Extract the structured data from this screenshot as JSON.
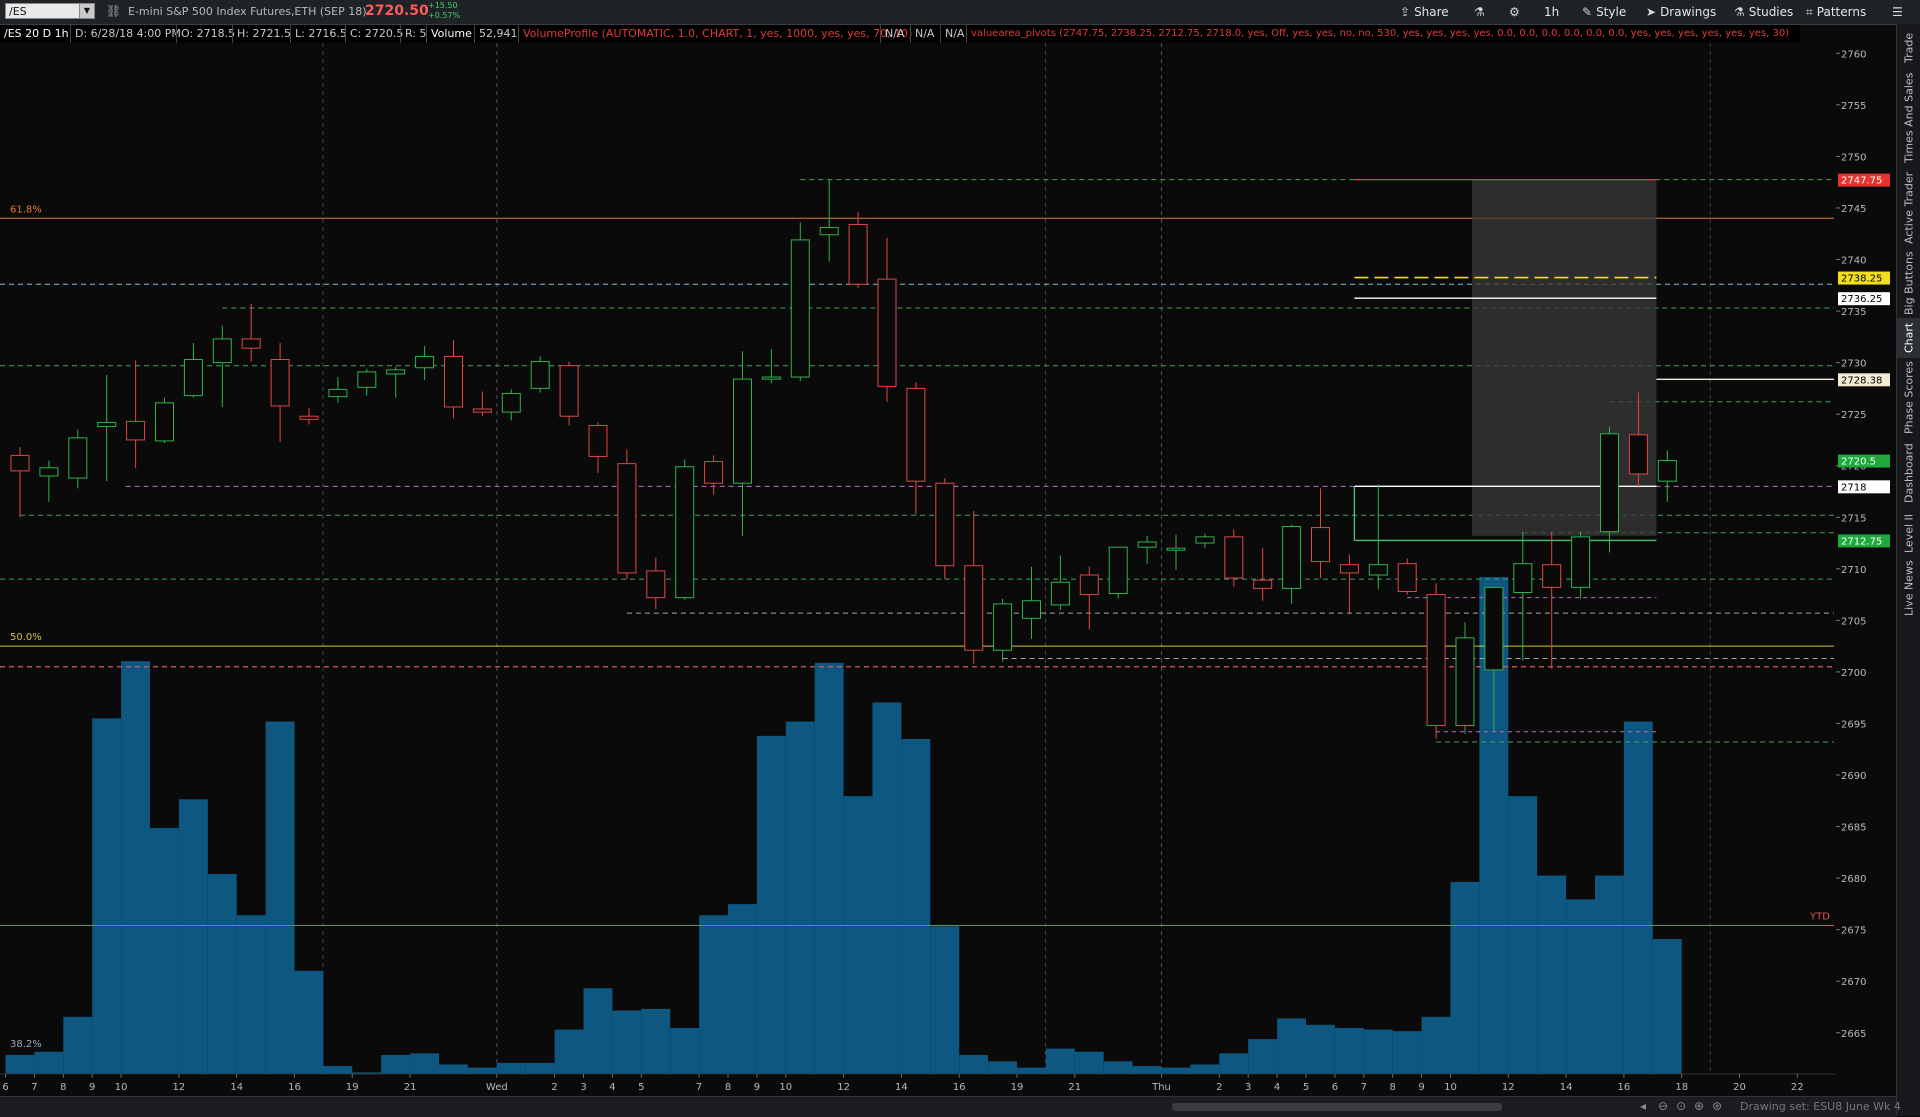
{
  "toolbar": {
    "symbol": "/ES",
    "instrument": "E-mini S&P 500 Index Futures,ETH (SEP 18)",
    "last": "2720.50",
    "change": "+15.50",
    "change_pct": "+0.57%",
    "buttons": {
      "share": "Share",
      "timeframe": "1h",
      "style": "Style",
      "drawings": "Drawings",
      "studies": "Studies",
      "patterns": "Patterns"
    }
  },
  "status": {
    "title": "/ES 20 D 1h",
    "date": "D: 6/28/18 4:00 PM",
    "open": "O: 2718.5",
    "high": "H: 2721.5",
    "low": "L: 2716.5",
    "close": "C: 2720.5",
    "range": "R: 5",
    "volume_label": "Volume",
    "volume_value": "52,941",
    "volume_profile": "VolumeProfile (AUTOMATIC, 1.0, CHART, 1, yes, 1000, yes, yes, 70, 10)",
    "na1": "N/A",
    "na2": "N/A",
    "na3": "N/A",
    "pivots": "valuearea_pivots (2747.75, 2738.25, 2712.75, 2718.0, yes, Off, yes, yes, no, no, 530, yes, yes, yes, yes, 0.0, 0.0, 0.0, 0.0, 0.0, 0.0, yes, yes, yes, yes, yes, yes, 30)"
  },
  "right_tabs": [
    "Trade",
    "Times And Sales",
    "Active Trader",
    "Big Buttons",
    "Chart",
    "Phase Scores",
    "Dashboard",
    "Level II",
    "Live News"
  ],
  "active_tab": "Chart",
  "footer": {
    "drawing_set": "Drawing set: ESU8 June Wk 4"
  },
  "chart_data": {
    "type": "candlestick",
    "ylim": [
      2661,
      2761
    ],
    "y_ticks": [
      "2760",
      "2755",
      "2750",
      "2745",
      "2740",
      "2735",
      "2730",
      "2725",
      "2720",
      "2715",
      "2710",
      "2705",
      "2700",
      "2695",
      "2690",
      "2685",
      "2680",
      "2675",
      "2670",
      "2665"
    ],
    "x_ticks": [
      {
        "label": "6",
        "i": 0
      },
      {
        "label": "7",
        "i": 1
      },
      {
        "label": "8",
        "i": 2
      },
      {
        "label": "9",
        "i": 3
      },
      {
        "label": "10",
        "i": 4
      },
      {
        "label": "12",
        "i": 6
      },
      {
        "label": "14",
        "i": 8
      },
      {
        "label": "16",
        "i": 10
      },
      {
        "label": "19",
        "i": 12
      },
      {
        "label": "21",
        "i": 14
      },
      {
        "label": "Wed",
        "i": 17
      },
      {
        "label": "2",
        "i": 19
      },
      {
        "label": "3",
        "i": 20
      },
      {
        "label": "4",
        "i": 21
      },
      {
        "label": "5",
        "i": 22
      },
      {
        "label": "7",
        "i": 24
      },
      {
        "label": "8",
        "i": 25
      },
      {
        "label": "9",
        "i": 26
      },
      {
        "label": "10",
        "i": 27
      },
      {
        "label": "12",
        "i": 29
      },
      {
        "label": "14",
        "i": 31
      },
      {
        "label": "16",
        "i": 33
      },
      {
        "label": "19",
        "i": 35
      },
      {
        "label": "21",
        "i": 37
      },
      {
        "label": "Thu",
        "i": 40
      },
      {
        "label": "2",
        "i": 42
      },
      {
        "label": "3",
        "i": 43
      },
      {
        "label": "4",
        "i": 44
      },
      {
        "label": "5",
        "i": 45
      },
      {
        "label": "6",
        "i": 46
      },
      {
        "label": "7",
        "i": 47
      },
      {
        "label": "8",
        "i": 48
      },
      {
        "label": "9",
        "i": 49
      },
      {
        "label": "10",
        "i": 50
      },
      {
        "label": "12",
        "i": 52
      },
      {
        "label": "14",
        "i": 54
      },
      {
        "label": "16",
        "i": 56
      },
      {
        "label": "18",
        "i": 58
      },
      {
        "label": "20",
        "i": 60
      },
      {
        "label": "22",
        "i": 62
      }
    ],
    "candles": [
      {
        "o": 2721.0,
        "h": 2721.8,
        "l": 2715.0,
        "c": 2719.5
      },
      {
        "o": 2719.0,
        "h": 2720.5,
        "l": 2716.5,
        "c": 2719.8
      },
      {
        "o": 2718.8,
        "h": 2723.5,
        "l": 2717.8,
        "c": 2722.7
      },
      {
        "o": 2723.8,
        "h": 2728.8,
        "l": 2718.5,
        "c": 2724.2
      },
      {
        "o": 2724.3,
        "h": 2730.2,
        "l": 2719.8,
        "c": 2722.5
      },
      {
        "o": 2722.4,
        "h": 2726.6,
        "l": 2722.2,
        "c": 2726.1
      },
      {
        "o": 2726.8,
        "h": 2731.9,
        "l": 2726.6,
        "c": 2730.3
      },
      {
        "o": 2730.0,
        "h": 2733.6,
        "l": 2725.7,
        "c": 2732.3
      },
      {
        "o": 2732.3,
        "h": 2735.7,
        "l": 2730.1,
        "c": 2731.4
      },
      {
        "o": 2730.3,
        "h": 2731.9,
        "l": 2722.3,
        "c": 2725.8
      },
      {
        "o": 2724.8,
        "h": 2725.6,
        "l": 2724.0,
        "c": 2724.5
      },
      {
        "o": 2726.7,
        "h": 2728.6,
        "l": 2726.1,
        "c": 2727.4
      },
      {
        "o": 2727.6,
        "h": 2729.4,
        "l": 2726.8,
        "c": 2729.1
      },
      {
        "o": 2728.9,
        "h": 2729.6,
        "l": 2726.6,
        "c": 2729.3
      },
      {
        "o": 2729.5,
        "h": 2731.6,
        "l": 2728.3,
        "c": 2730.6
      },
      {
        "o": 2730.6,
        "h": 2732.2,
        "l": 2724.6,
        "c": 2725.7
      },
      {
        "o": 2725.5,
        "h": 2727.2,
        "l": 2724.8,
        "c": 2725.2
      },
      {
        "o": 2725.2,
        "h": 2727.4,
        "l": 2724.4,
        "c": 2727.0
      },
      {
        "o": 2727.5,
        "h": 2730.6,
        "l": 2727.1,
        "c": 2730.1
      },
      {
        "o": 2729.7,
        "h": 2730.1,
        "l": 2723.9,
        "c": 2724.8
      },
      {
        "o": 2723.9,
        "h": 2724.2,
        "l": 2719.3,
        "c": 2720.9
      },
      {
        "o": 2720.2,
        "h": 2721.6,
        "l": 2709.0,
        "c": 2709.6
      },
      {
        "o": 2709.8,
        "h": 2711.1,
        "l": 2706.1,
        "c": 2707.2
      },
      {
        "o": 2707.2,
        "h": 2720.6,
        "l": 2707.0,
        "c": 2719.9
      },
      {
        "o": 2720.4,
        "h": 2721.0,
        "l": 2717.2,
        "c": 2718.3
      },
      {
        "o": 2718.3,
        "h": 2731.1,
        "l": 2713.2,
        "c": 2728.4
      },
      {
        "o": 2728.4,
        "h": 2731.3,
        "l": 2728.0,
        "c": 2728.6
      },
      {
        "o": 2728.6,
        "h": 2743.6,
        "l": 2728.2,
        "c": 2741.9
      },
      {
        "o": 2742.4,
        "h": 2747.8,
        "l": 2739.8,
        "c": 2743.1
      },
      {
        "o": 2743.4,
        "h": 2744.6,
        "l": 2737.2,
        "c": 2737.6
      },
      {
        "o": 2738.1,
        "h": 2742.1,
        "l": 2726.2,
        "c": 2727.7
      },
      {
        "o": 2727.5,
        "h": 2728.1,
        "l": 2715.3,
        "c": 2718.5
      },
      {
        "o": 2718.3,
        "h": 2718.8,
        "l": 2709.0,
        "c": 2710.3
      },
      {
        "o": 2710.3,
        "h": 2715.6,
        "l": 2700.8,
        "c": 2702.1
      },
      {
        "o": 2702.1,
        "h": 2707.1,
        "l": 2701.0,
        "c": 2706.6
      },
      {
        "o": 2705.2,
        "h": 2710.2,
        "l": 2703.2,
        "c": 2706.9
      },
      {
        "o": 2706.5,
        "h": 2711.3,
        "l": 2706.0,
        "c": 2708.7
      },
      {
        "o": 2709.4,
        "h": 2710.2,
        "l": 2704.1,
        "c": 2707.5
      },
      {
        "o": 2707.6,
        "h": 2712.0,
        "l": 2707.1,
        "c": 2712.1
      },
      {
        "o": 2712.1,
        "h": 2713.2,
        "l": 2710.5,
        "c": 2712.6
      },
      {
        "o": 2711.8,
        "h": 2713.3,
        "l": 2709.9,
        "c": 2712.0
      },
      {
        "o": 2712.5,
        "h": 2713.4,
        "l": 2712.0,
        "c": 2713.1
      },
      {
        "o": 2713.1,
        "h": 2713.8,
        "l": 2708.3,
        "c": 2709.1
      },
      {
        "o": 2708.9,
        "h": 2712.0,
        "l": 2706.9,
        "c": 2708.1
      },
      {
        "o": 2708.1,
        "h": 2714.3,
        "l": 2706.6,
        "c": 2714.1
      },
      {
        "o": 2714.0,
        "h": 2717.8,
        "l": 2709.1,
        "c": 2710.7
      },
      {
        "o": 2710.4,
        "h": 2711.4,
        "l": 2705.6,
        "c": 2709.6
      },
      {
        "o": 2709.4,
        "h": 2718.2,
        "l": 2708.0,
        "c": 2710.4
      },
      {
        "o": 2710.5,
        "h": 2711.0,
        "l": 2707.5,
        "c": 2707.8
      },
      {
        "o": 2707.5,
        "h": 2708.6,
        "l": 2693.5,
        "c": 2694.8
      },
      {
        "o": 2694.8,
        "h": 2704.8,
        "l": 2694.0,
        "c": 2703.3
      },
      {
        "o": 2700.2,
        "h": 2708.3,
        "l": 2694.3,
        "c": 2708.2
      },
      {
        "o": 2707.7,
        "h": 2713.6,
        "l": 2701.1,
        "c": 2710.5
      },
      {
        "o": 2710.4,
        "h": 2713.6,
        "l": 2700.3,
        "c": 2708.2
      },
      {
        "o": 2708.2,
        "h": 2713.6,
        "l": 2707.1,
        "c": 2713.1
      },
      {
        "o": 2713.6,
        "h": 2723.8,
        "l": 2711.6,
        "c": 2723.1
      },
      {
        "o": 2723.0,
        "h": 2727.1,
        "l": 2717.8,
        "c": 2719.2
      },
      {
        "o": 2718.5,
        "h": 2721.5,
        "l": 2716.5,
        "c": 2720.5
      }
    ],
    "volume_profile": {
      "price_max": 2709.2,
      "bars": [
        1.2,
        1.4,
        3.6,
        22.4,
        26.0,
        15.5,
        17.3,
        12.6,
        10.0,
        22.2,
        6.5,
        0.5,
        0.1,
        1.2,
        1.3,
        0.6,
        0.4,
        0.7,
        0.7,
        2.8,
        5.4,
        4.0,
        4.1,
        2.9,
        10.0,
        10.7,
        21.3,
        22.2,
        25.9,
        17.5,
        23.4,
        21.1,
        9.3,
        1.2,
        0.8,
        0.4,
        1.6,
        1.4,
        0.8,
        0.5,
        0.4,
        0.6,
        1.3,
        2.2,
        3.5,
        3.1,
        2.9,
        2.8,
        2.7,
        3.6,
        12.1,
        31.3,
        17.5,
        12.5,
        11.0,
        12.5,
        22.2,
        8.5,
        0,
        0,
        0,
        0,
        0,
        0
      ]
    },
    "levels": [
      {
        "price": 2747.75,
        "color": "#4ac26b",
        "dash": true,
        "label": "2747.75",
        "label_bg": "#e3342f",
        "label_fg": "#ffffff"
      },
      {
        "price": 2738.25,
        "color": "#f2d63a",
        "dash": true,
        "label": "2738.25",
        "label_bg": "#f2e01f",
        "label_fg": "#000000"
      },
      {
        "price": 2736.25,
        "color": "#ffffff",
        "dash": false,
        "label": "2736.25",
        "label_bg": "#ffffff",
        "label_fg": "#000000"
      },
      {
        "price": 2728.38,
        "color": "#f5e9c6",
        "dash": false,
        "label": "2728.38",
        "label_bg": "#f3ecd2",
        "label_fg": "#000000"
      },
      {
        "price": 2720.5,
        "color": "#4ac26b",
        "dash": false,
        "label": "2720.5",
        "label_bg": "#1fa83b",
        "label_fg": "#ffffff"
      },
      {
        "price": 2718.0,
        "color": "#ffffff",
        "dash": false,
        "label": "2718",
        "label_bg": "#ffffff",
        "label_fg": "#000000"
      },
      {
        "price": 2712.75,
        "color": "#4ac26b",
        "dash": false,
        "label": "2712.75",
        "label_bg": "#1fa83b",
        "label_fg": "#ffffff"
      }
    ],
    "fib_labels": {
      "fib618": "61.8%",
      "fib50": "50.0%",
      "fib382": "38.2%",
      "ytd": "YTD"
    }
  }
}
